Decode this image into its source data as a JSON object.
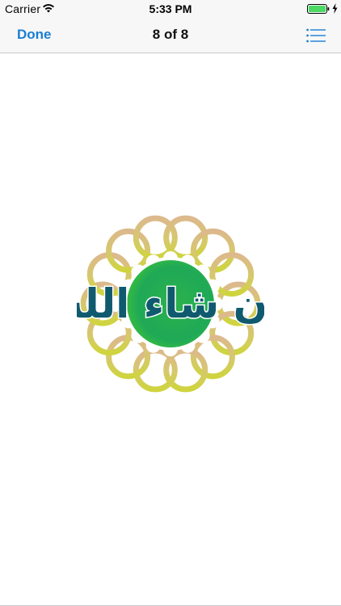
{
  "status_bar": {
    "carrier": "Carrier",
    "time": "5:33 PM",
    "battery_color": "#4cd964",
    "icons": [
      "wifi-icon",
      "battery-icon",
      "charging-icon"
    ]
  },
  "nav_bar": {
    "done_label": "Done",
    "title": "8 of 8",
    "list_icon": "list-icon",
    "accent_color": "#1a7fd4"
  },
  "content": {
    "sticker_text": "إن شاء الله",
    "sticker_colors": {
      "ring_gold": "#d8c86a",
      "ring_tan": "#d9b98a",
      "ring_yellow": "#cfd24a",
      "center_green": "#2fb84a",
      "text_teal": "#0f5a6e",
      "text_outline": "#ffffff"
    }
  }
}
